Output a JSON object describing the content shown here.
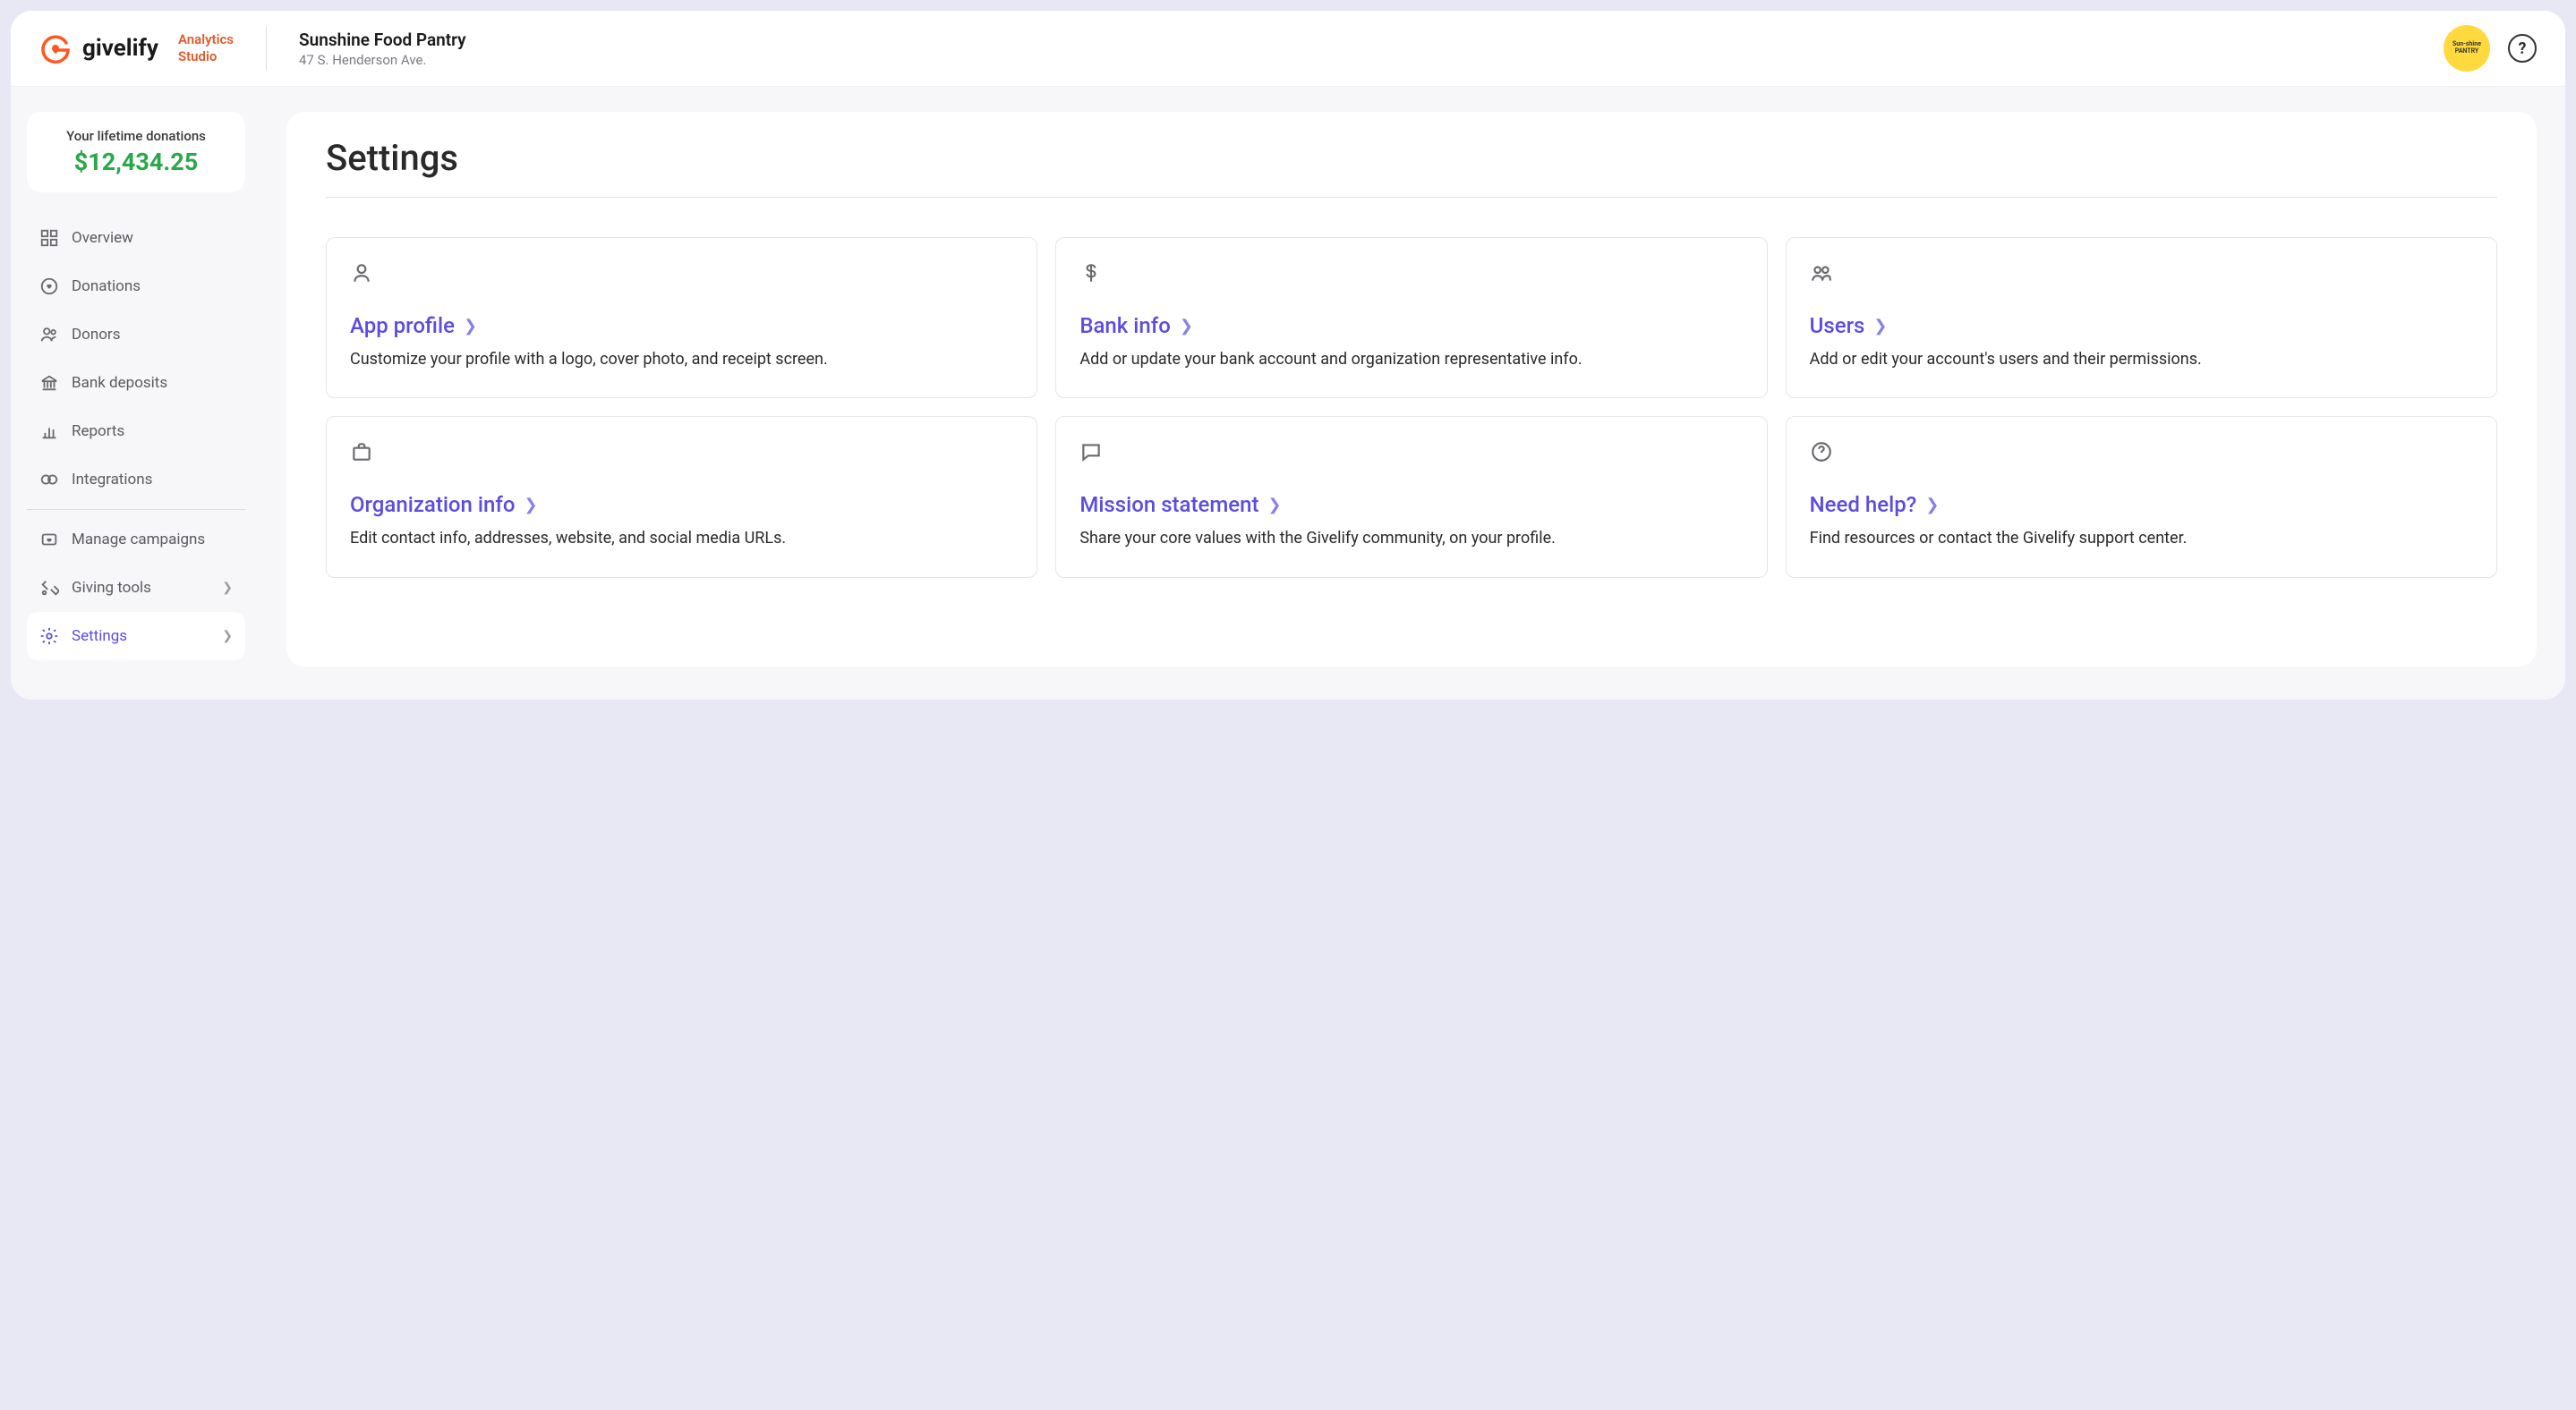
{
  "header": {
    "logo_text": "givelify",
    "studio_line1": "Analytics",
    "studio_line2": "Studio",
    "org_name": "Sunshine Food Pantry",
    "org_address": "47 S. Henderson Ave.",
    "avatar_text": "Sun-shine PANTRY"
  },
  "sidebar": {
    "donation_label": "Your lifetime donations",
    "donation_amount": "$12,434.25",
    "items": [
      {
        "label": "Overview"
      },
      {
        "label": "Donations"
      },
      {
        "label": "Donors"
      },
      {
        "label": "Bank deposits"
      },
      {
        "label": "Reports"
      },
      {
        "label": "Integrations"
      }
    ],
    "items2": [
      {
        "label": "Manage campaigns"
      },
      {
        "label": "Giving tools"
      },
      {
        "label": "Settings"
      }
    ]
  },
  "main": {
    "title": "Settings",
    "cards": [
      {
        "title": "App profile",
        "desc": "Customize your profile with a logo, cover photo, and receipt screen."
      },
      {
        "title": "Bank info",
        "desc": "Add or update your bank account and organization representative info."
      },
      {
        "title": "Users",
        "desc": "Add or edit your account's users and their permissions."
      },
      {
        "title": "Organization info",
        "desc": "Edit contact info, addresses, website, and social media URLs."
      },
      {
        "title": "Mission statement",
        "desc": "Share your core values with the Givelify community, on your profile."
      },
      {
        "title": "Need help?",
        "desc": "Find resources or contact the Givelify support center."
      }
    ]
  }
}
